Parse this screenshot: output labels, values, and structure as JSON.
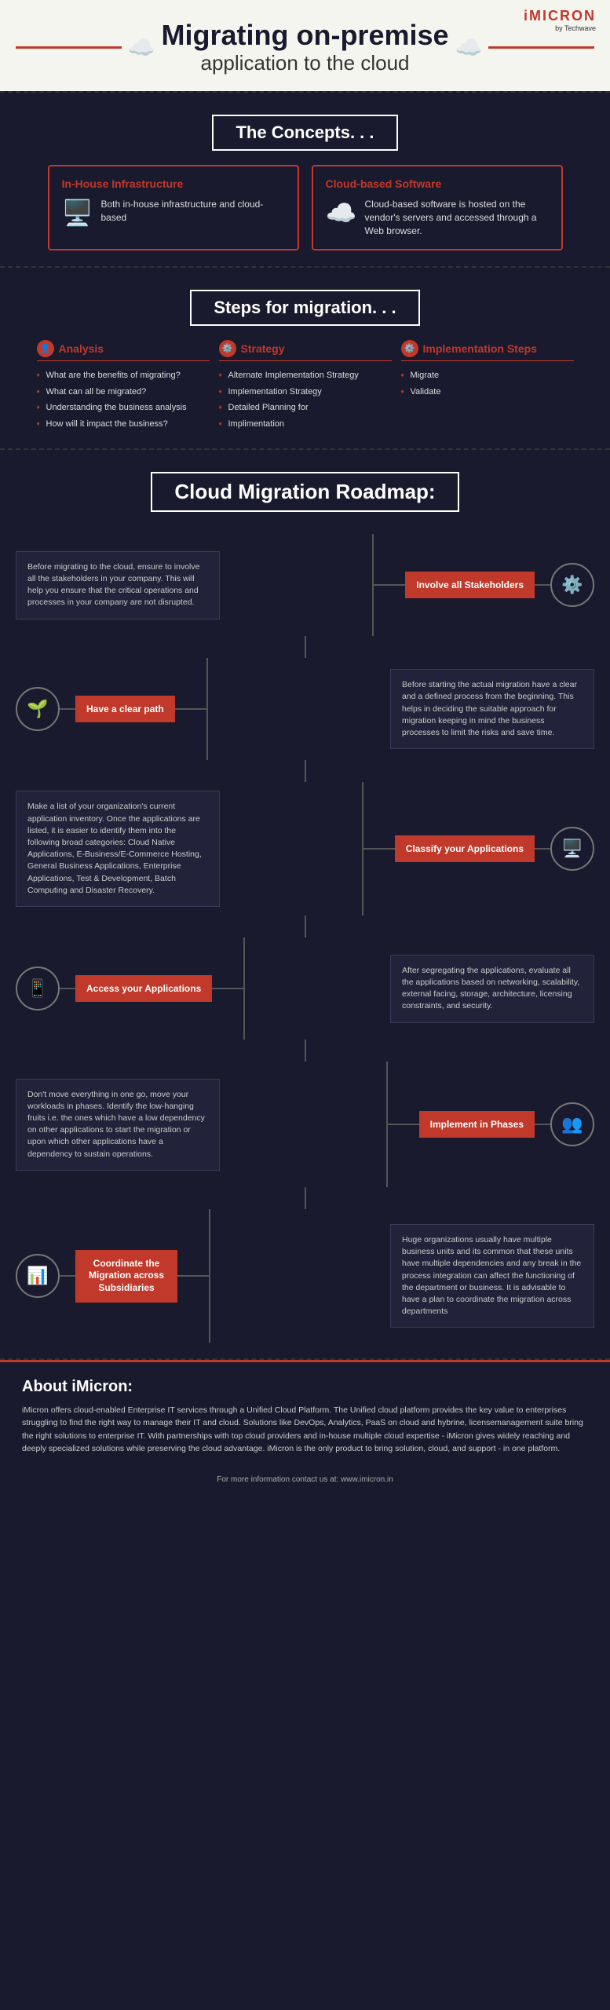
{
  "logo": {
    "brand": "iMICRON",
    "by": "by Techwave"
  },
  "header": {
    "title": "Migrating on-premise",
    "subtitle": "application to the cloud"
  },
  "concepts": {
    "section_title": "The Concepts. . .",
    "items": [
      {
        "title": "In-House Infrastructure",
        "text": "Both in-house infrastructure and cloud-based",
        "icon": "🖥️"
      },
      {
        "title": "Cloud-based Software",
        "text": "Cloud-based software is hosted on the vendor's servers and accessed through a Web browser.",
        "icon": "☁️"
      }
    ]
  },
  "steps": {
    "section_title": "Steps for migration. . .",
    "columns": [
      {
        "title": "Analysis",
        "icon": "👤",
        "items": [
          "What are the benefits of migrating?",
          "What can all be migrated?",
          "Understanding the business analysis",
          "How will it impact the business?"
        ]
      },
      {
        "title": "Strategy",
        "icon": "⚙️",
        "items": [
          "Alternate Implementation Strategy",
          "Implementation Strategy",
          "Detailed Planning for",
          "Implimentation"
        ]
      },
      {
        "title": "Implementation Steps",
        "icon": "⚙️",
        "items": [
          "Migrate",
          "Validate"
        ]
      }
    ]
  },
  "roadmap": {
    "section_title": "Cloud Migration Roadmap:",
    "steps": [
      {
        "label": "Involve all Stakeholders",
        "side": "right",
        "icon": "⚙️",
        "text": "Before migrating to the cloud, ensure to involve all the stakeholders in your company. This will help you ensure that the critical operations and processes in your company are not disrupted."
      },
      {
        "label": "Have a clear path",
        "side": "left",
        "icon": "🌱",
        "text": "Before starting the actual migration have a clear and a defined process from the beginning. This helps in deciding the suitable approach for migration keeping in mind the business processes to limit the risks and save time."
      },
      {
        "label": "Classify your Applications",
        "side": "right",
        "icon": "🖥️",
        "text": "Make a list of your organization's current application inventory. Once the applications are listed, it is easier to identify them into the following broad categories: Cloud Native Applications, E-Business/E-Commerce Hosting, General Business Applications, Enterprise Applications, Test & Development, Batch Computing and Disaster Recovery."
      },
      {
        "label": "Access your Applications",
        "side": "left",
        "icon": "📱",
        "text": "After segregating the applications, evaluate all the applications based on networking, scalability, external facing, storage, architecture, licensing constraints, and security."
      },
      {
        "label": "Implement in Phases",
        "side": "right",
        "icon": "👥",
        "text": "Don't move everything in one go, move your workloads in phases. Identify the low-hanging fruits i.e. the ones which have a low dependency on other applications to start the migration or upon which other applications have a dependency to sustain operations."
      },
      {
        "label": "Coordinate the Migration across Subsidiaries",
        "side": "left",
        "icon": "📊",
        "text": "Huge organizations usually have multiple business units and its common that these units have multiple dependencies and any break in the process integration can affect the functioning of the department or business. It is advisable to have a plan to coordinate the migration across departments"
      }
    ]
  },
  "about": {
    "title": "About iMicron:",
    "text": "iMicron offers cloud-enabled Enterprise IT services through a Unified Cloud Platform. The Unified cloud platform provides the key value to enterprises struggling to find the right way to manage their IT and cloud. Solutions like DevOps, Analytics, PaaS on cloud and hybrine, licensemanagement suite bring the right solutions to enterprise IT. With partnerships with top cloud providers and in-house multiple cloud expertise - iMicron gives widely reaching and deeply specialized solutions while preserving the cloud advantage. iMicron is the only product to bring solution, cloud, and support - in one platform.",
    "contact": "For more information contact us at: www.imicron.in"
  }
}
